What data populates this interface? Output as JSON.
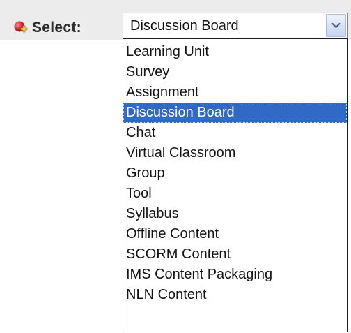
{
  "toolbar": {
    "label": "Select:",
    "icon": "add-plus-icon",
    "colors": {
      "background": "#ececec",
      "icon_red": "#c2262d",
      "icon_plus": "#f0c23c"
    }
  },
  "select": {
    "value": "Discussion Board",
    "arrow_icon": "chevron-down-icon",
    "options": [
      {
        "label": "Learning Unit",
        "selected": false
      },
      {
        "label": "Survey",
        "selected": false
      },
      {
        "label": "Assignment",
        "selected": false
      },
      {
        "label": "Discussion Board",
        "selected": true
      },
      {
        "label": "Chat",
        "selected": false
      },
      {
        "label": "Virtual Classroom",
        "selected": false
      },
      {
        "label": "Group",
        "selected": false
      },
      {
        "label": "Tool",
        "selected": false
      },
      {
        "label": "Syllabus",
        "selected": false
      },
      {
        "label": "Offline Content",
        "selected": false
      },
      {
        "label": "SCORM Content",
        "selected": false
      },
      {
        "label": "IMS Content Packaging",
        "selected": false
      },
      {
        "label": "NLN Content",
        "selected": false
      }
    ],
    "colors": {
      "highlight": "#3169c6",
      "highlight_text": "#ffffff"
    }
  }
}
